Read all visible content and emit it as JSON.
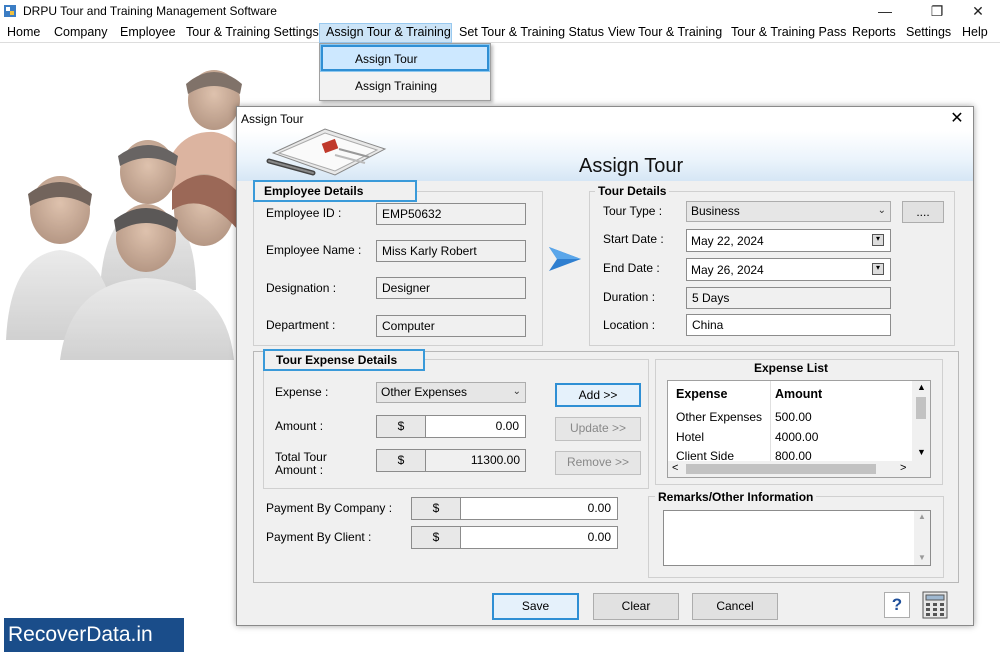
{
  "app": {
    "title": "DRPU Tour and Training Management Software",
    "window_buttons": [
      "—",
      "❐",
      "✕"
    ]
  },
  "menu": {
    "items": [
      "Home",
      "Company",
      "Employee",
      "Tour & Training Settings",
      "Assign Tour & Training",
      "Set Tour & Training Status",
      "View Tour & Training",
      "Tour & Training Pass",
      "Reports",
      "Settings",
      "Help"
    ],
    "dropdown": [
      "Assign Tour",
      "Assign Training"
    ]
  },
  "dialog": {
    "title": "Assign Tour",
    "close": "✕",
    "banner_title": "Assign Tour",
    "employee": {
      "group_label": "Employee Details",
      "id_label": "Employee ID :",
      "id_value": "EMP50632",
      "name_label": "Employee Name :",
      "name_value": "Miss Karly Robert",
      "designation_label": "Designation :",
      "designation_value": "Designer",
      "department_label": "Department :",
      "department_value": "Computer"
    },
    "tour": {
      "group_label": "Tour Details",
      "type_label": "Tour Type :",
      "type_value": "Business",
      "more_button": "....",
      "start_label": "Start Date :",
      "start_value": "May 22, 2024",
      "end_label": "End Date :",
      "end_value": "May 26, 2024",
      "duration_label": "Duration :",
      "duration_value": "5 Days",
      "location_label": "Location :",
      "location_value": "China"
    },
    "expense": {
      "group_label": "Tour Expense Details",
      "expense_label": "Expense :",
      "expense_value": "Other Expenses",
      "amount_label": "Amount :",
      "currency": "$",
      "amount_value": "0.00",
      "total_label_1": "Total Tour",
      "total_label_2": "Amount :",
      "total_value": "11300.00",
      "add_button": "Add >>",
      "update_button": "Update >>",
      "remove_button": "Remove >>",
      "list_title": "Expense List",
      "list_headers": [
        "Expense",
        "Amount"
      ],
      "list_rows": [
        [
          "Other Expenses",
          "500.00"
        ],
        [
          "Hotel",
          "4000.00"
        ],
        [
          "Client Side",
          "800.00"
        ]
      ]
    },
    "payment": {
      "company_label": "Payment By Company :",
      "company_value": "0.00",
      "client_label": "Payment By Client :",
      "client_value": "0.00",
      "currency": "$"
    },
    "remarks": {
      "group_label": "Remarks/Other Information",
      "value": ""
    },
    "buttons": {
      "save": "Save",
      "clear": "Clear",
      "cancel": "Cancel",
      "help": "?"
    }
  },
  "watermark": "RecoverData.in",
  "colors": {
    "accent_highlight": "#3a9ad9",
    "banner_blue": "#d6e6f5",
    "watermark_bg": "#1a4d8a"
  }
}
